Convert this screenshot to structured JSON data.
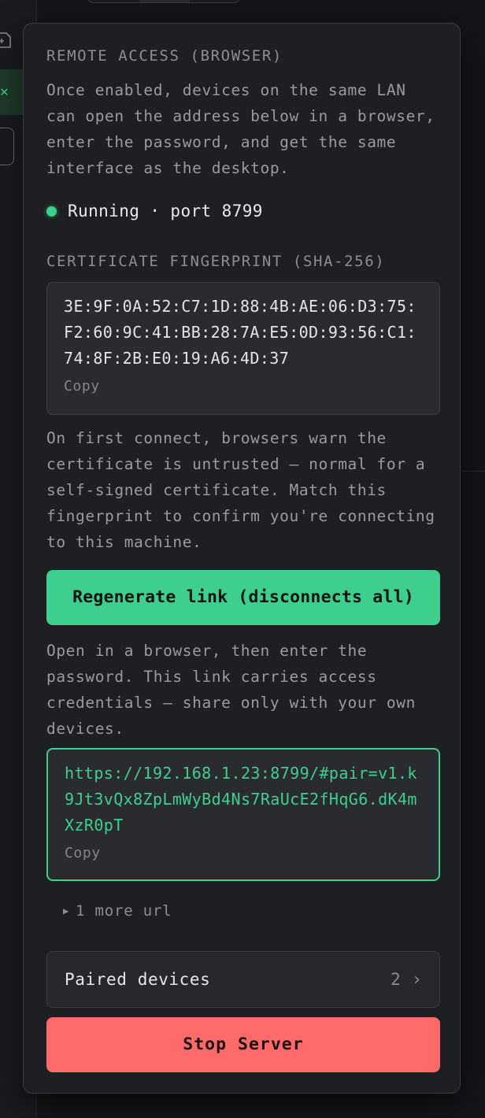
{
  "background": {
    "file_icon": "file-add-icon",
    "close_glyph": "✕"
  },
  "remote_access": {
    "title": "REMOTE ACCESS (BROWSER)",
    "description": "Once enabled, devices on the same LAN can open the address below in a browser, enter the password, and get the same interface as the desktop.",
    "status": {
      "text": "Running · port 8799",
      "color": "#3ecf8e"
    }
  },
  "certificate": {
    "title": "CERTIFICATE FINGERPRINT (SHA-256)",
    "fingerprint": "3E:9F:0A:52:C7:1D:88:4B:AE:06:D3:75:F2:60:9C:41:BB:28:7A:E5:0D:93:56:C1:74:8F:2B:E0:19:A6:4D:37",
    "copy_label": "Copy",
    "note": "On first connect, browsers warn the certificate is untrusted — normal for a self-signed certificate. Match this fingerprint to confirm you're connecting to this machine."
  },
  "regenerate_button": {
    "label": "Regenerate link (disconnects all)",
    "color": "#3ecf8e"
  },
  "link": {
    "instructions": "Open in a browser, then enter the password. This link carries access credentials — share only with your own devices.",
    "url": "https://192.168.1.23:8799/#pair=v1.k9Jt3vQx8ZpLmWyBd4Ns7RaUcE2fHqG6.dK4mXzR0pT",
    "copy_label": "Copy",
    "more_urls": "1 more url",
    "more_icon": "triangle-right-icon"
  },
  "paired_devices": {
    "label": "Paired devices",
    "count": "2",
    "icon": "chevron-right-icon"
  },
  "stop_button": {
    "label": "Stop Server",
    "color": "#ff6b6b"
  }
}
